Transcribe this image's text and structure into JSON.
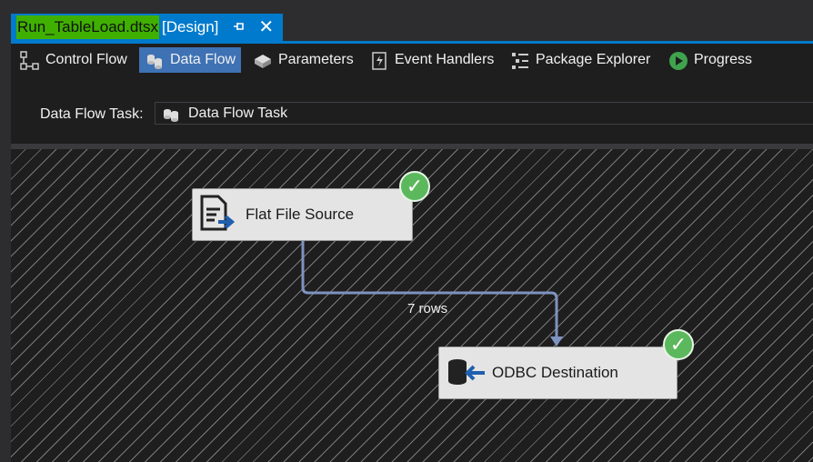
{
  "document_tab": {
    "filename": "Run_TableLoad.dtsx",
    "mode": "[Design]",
    "pin_icon": "pin-icon",
    "close_icon": "close-icon"
  },
  "designer_tabs": [
    {
      "label": "Control Flow",
      "icon": "control-flow-icon",
      "active": false
    },
    {
      "label": "Data Flow",
      "icon": "data-flow-icon",
      "active": true
    },
    {
      "label": "Parameters",
      "icon": "parameters-icon",
      "active": false
    },
    {
      "label": "Event Handlers",
      "icon": "event-handlers-icon",
      "active": false
    },
    {
      "label": "Package Explorer",
      "icon": "package-explorer-icon",
      "active": false
    },
    {
      "label": "Progress",
      "icon": "progress-play-icon",
      "active": false
    }
  ],
  "task_selector": {
    "label": "Data Flow Task:",
    "selected": "Data Flow Task"
  },
  "components": [
    {
      "name": "Flat File Source",
      "icon": "flat-file-source-icon",
      "status": "success"
    },
    {
      "name": "ODBC Destination",
      "icon": "odbc-destination-icon",
      "status": "success"
    }
  ],
  "data_path": {
    "label": "7 rows"
  },
  "colors": {
    "accent": "#007acc",
    "active_tab": "#3e72b4",
    "filename_highlight": "#3fb000",
    "success": "#5cb85c",
    "path_line": "#7d93c0"
  }
}
